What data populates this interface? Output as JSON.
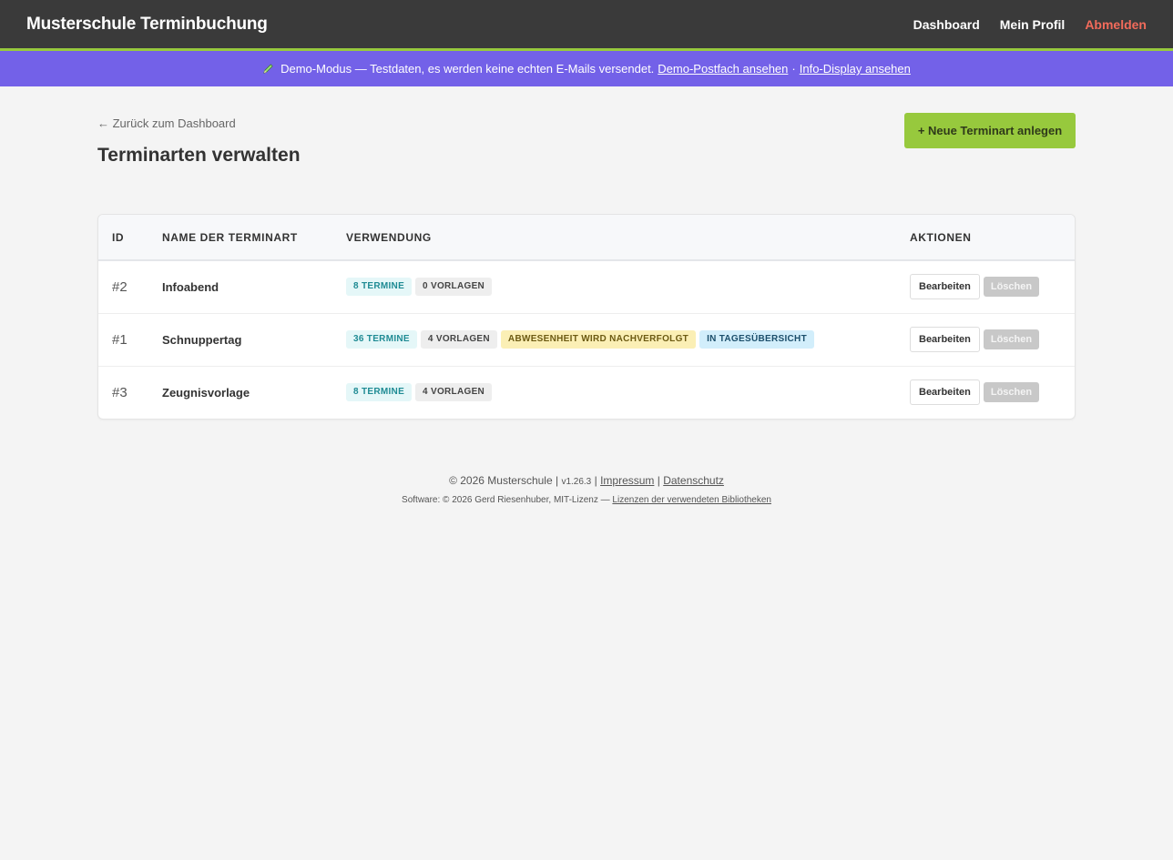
{
  "header": {
    "brand": "Musterschule Terminbuchung",
    "nav": {
      "dashboard": "Dashboard",
      "profile": "Mein Profil",
      "logout": "Abmelden"
    }
  },
  "demo_banner": {
    "icon": "pencil-icon",
    "text": "Demo-Modus — Testdaten, es werden keine echten E-Mails versendet.",
    "link_mailbox": "Demo-Postfach ansehen",
    "separator": "·",
    "link_display": "Info-Display ansehen"
  },
  "page": {
    "back_link": "← Zurück zum Dashboard",
    "title": "Terminarten verwalten",
    "new_button": "+ Neue Terminart anlegen"
  },
  "table": {
    "columns": {
      "id": "ID",
      "name": "Name der Terminart",
      "usage": "Verwendung",
      "actions": "Aktionen"
    },
    "rows": [
      {
        "id": "#2",
        "name": "Infoabend",
        "badges": {
          "termine": "8 Termine",
          "vorlagen": "0 Vorlagen"
        }
      },
      {
        "id": "#1",
        "name": "Schnuppertag",
        "badges": {
          "termine": "36 Termine",
          "vorlagen": "4 Vorlagen",
          "abwesenheit": "Abwesenheit wird nachverfolgt",
          "tages": "In Tagesübersicht"
        }
      },
      {
        "id": "#3",
        "name": "Zeugnisvorlage",
        "badges": {
          "termine": "8 Termine",
          "vorlagen": "4 Vorlagen"
        }
      }
    ],
    "edit_label": "Bearbeiten",
    "delete_label": "Löschen"
  },
  "footer": {
    "copyright": "© 2026 Musterschule |",
    "version": "v1.26.3",
    "pipe1": "|",
    "impressum": "Impressum",
    "pipe2": "|",
    "datenschutz": "Datenschutz",
    "software": "Software: © 2026 Gerd Riesenhuber, MIT-Lizenz —",
    "licenses": "Lizenzen der verwendeten Bibliotheken"
  },
  "colors": {
    "topbar": "#3a3a3a",
    "accent": "#97c93d",
    "banner": "#7361e8",
    "logout": "#f26b5b"
  }
}
